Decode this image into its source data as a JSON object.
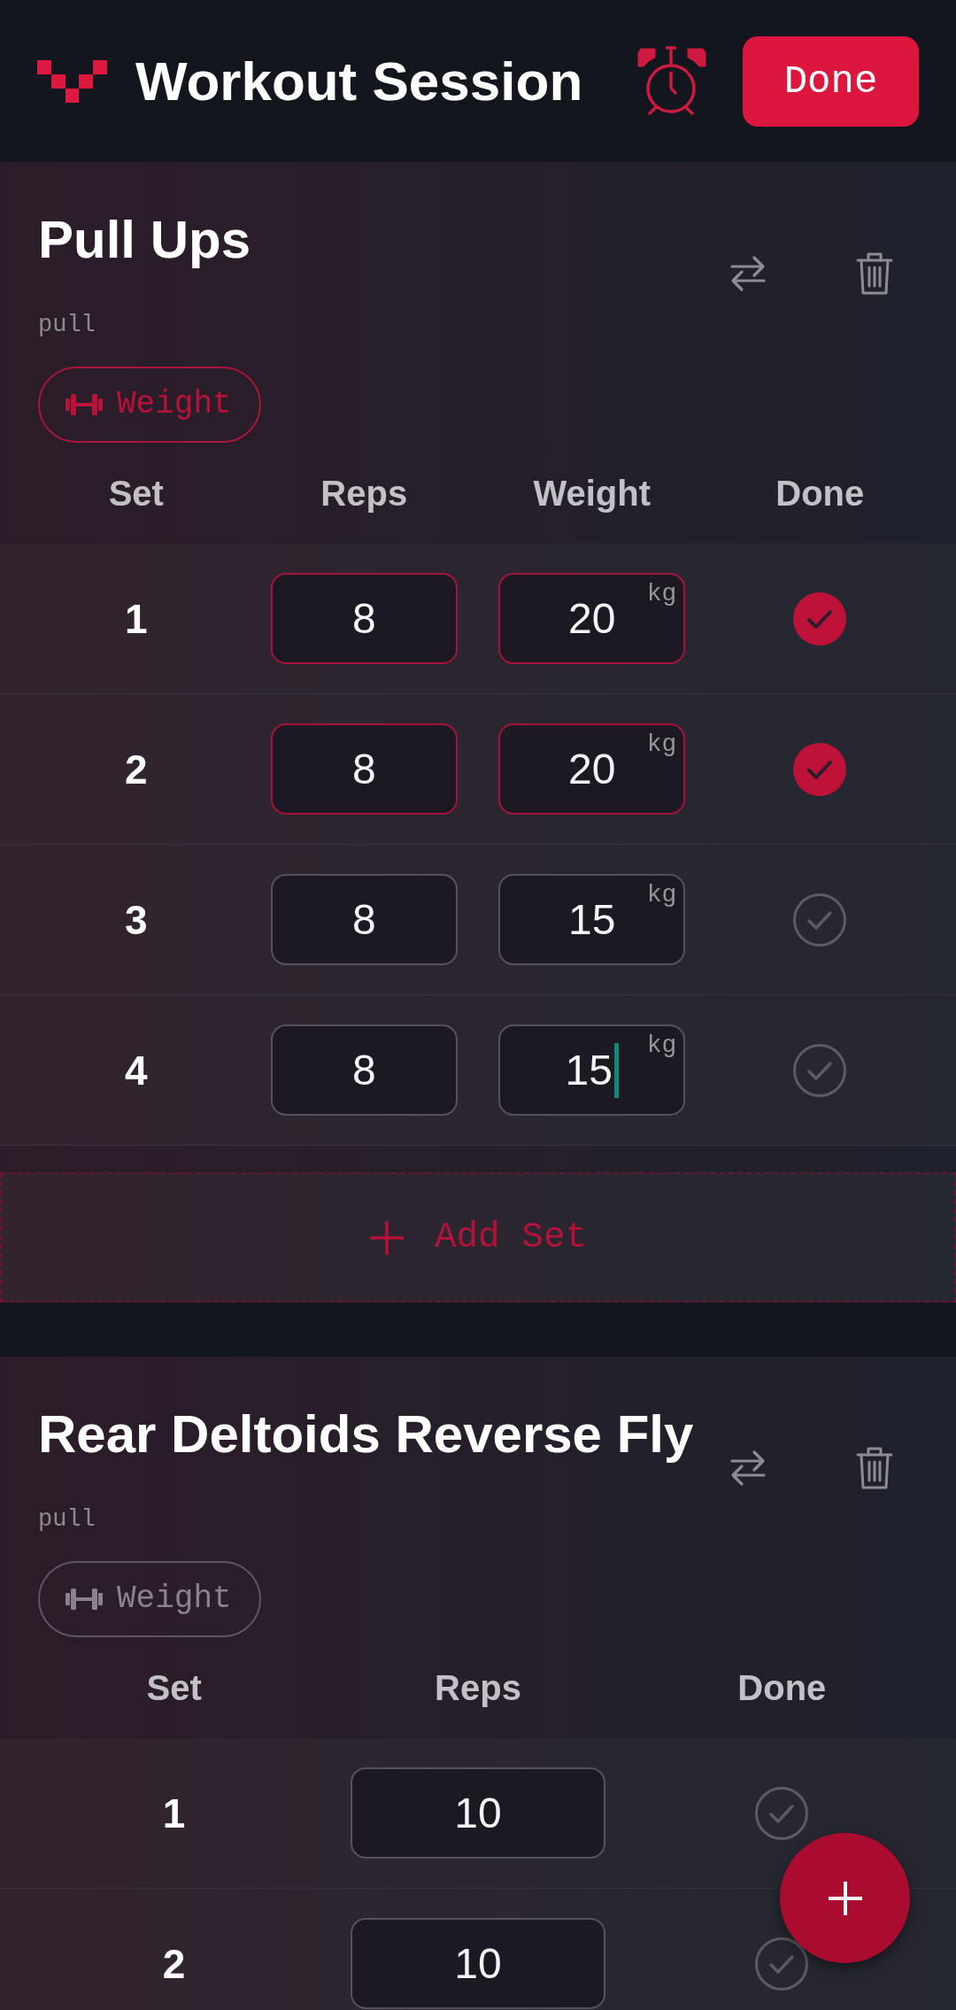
{
  "header": {
    "title": "Workout Session",
    "done_button": "Done"
  },
  "exercises": [
    {
      "name": "Pull Ups",
      "category": "pull",
      "tags": [
        {
          "label": "Weight",
          "selected": true
        }
      ],
      "columns": [
        {
          "label": "Set",
          "kind": "set"
        },
        {
          "label": "Reps",
          "kind": "reps"
        },
        {
          "label": "Weight",
          "kind": "weight"
        },
        {
          "label": "Done",
          "kind": "done"
        }
      ],
      "sets": [
        {
          "number": "1",
          "reps": "8",
          "weight": {
            "value": "20",
            "unit": "kg",
            "focused": false
          },
          "done": true
        },
        {
          "number": "2",
          "reps": "8",
          "weight": {
            "value": "20",
            "unit": "kg",
            "focused": false
          },
          "done": true
        },
        {
          "number": "3",
          "reps": "8",
          "weight": {
            "value": "15",
            "unit": "kg",
            "focused": false
          },
          "done": false
        },
        {
          "number": "4",
          "reps": "8",
          "weight": {
            "value": "15",
            "unit": "kg",
            "focused": true
          },
          "done": false
        }
      ],
      "add_set_button": "Add Set"
    },
    {
      "name": "Rear Deltoids Reverse Fly",
      "category": "pull",
      "tags": [
        {
          "label": "Weight",
          "selected": false
        }
      ],
      "columns": [
        {
          "label": "Set",
          "kind": "set"
        },
        {
          "label": "Reps",
          "kind": "reps"
        },
        {
          "label": "Done",
          "kind": "done"
        }
      ],
      "sets": [
        {
          "number": "1",
          "reps": "10",
          "done": false
        },
        {
          "number": "2",
          "reps": "10",
          "done": false
        }
      ]
    }
  ]
}
